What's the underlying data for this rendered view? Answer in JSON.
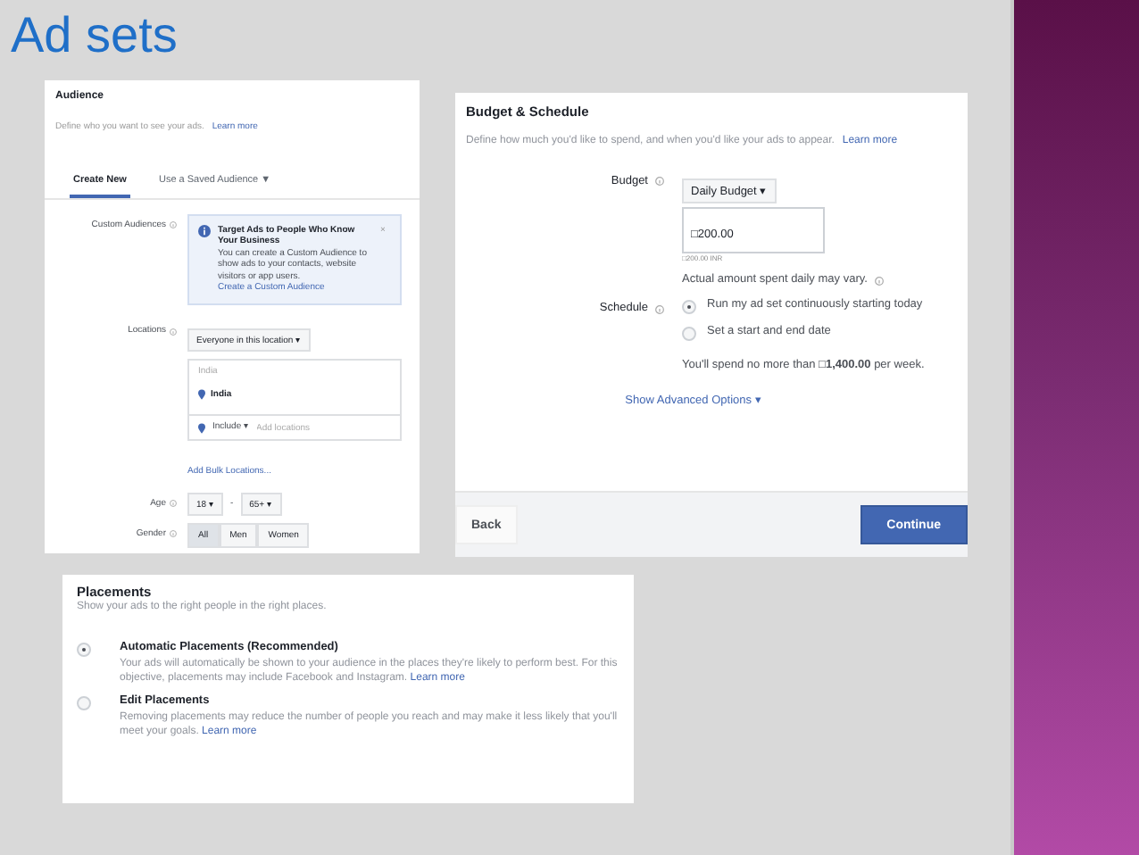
{
  "slide_title": "Ad sets",
  "audience": {
    "title": "Audience",
    "subtitle": "Define who you want to see your ads.",
    "subtitle_link": "Learn more",
    "tabs": [
      {
        "label": "Create New",
        "selected": true
      },
      {
        "label": "Use a Saved Audience ▼",
        "selected": false
      }
    ],
    "custom_audiences": {
      "label": "Custom Audiences",
      "notice_title": "Target Ads to People Who Know Your Business",
      "notice_body": "You can create a Custom Audience to show ads to your contacts, website visitors or app users.",
      "notice_link": "Create a Custom Audience",
      "close": "×"
    },
    "locations": {
      "label": "Locations",
      "dropdown": "Everyone in this location ▾",
      "search_hint": "India",
      "location": "India",
      "include": "Include ▾",
      "placeholder": "Add locations",
      "bulk_link": "Add Bulk Locations..."
    },
    "age": {
      "label": "Age",
      "from": "18 ▾",
      "dash": "-",
      "to": "65+ ▾"
    },
    "gender": {
      "label": "Gender",
      "options": [
        {
          "label": "All",
          "selected": true
        },
        {
          "label": "Men",
          "selected": false
        },
        {
          "label": "Women",
          "selected": false
        }
      ]
    }
  },
  "budget": {
    "title": "Budget & Schedule",
    "subtitle": "Define how much you'd like to spend, and when you'd like your ads to appear.",
    "subtitle_link": "Learn more",
    "budget_label": "Budget",
    "budget_type": "Daily Budget ▾",
    "amount": "□200.00",
    "amount_note": "□200.00 INR",
    "note": "Actual amount spent daily may vary.",
    "schedule_label": "Schedule",
    "schedule_options": [
      {
        "label": "Run my ad set continuously starting today",
        "selected": true
      },
      {
        "label": "Set a start and end date",
        "selected": false
      }
    ],
    "spend_note": "You'll spend no more than **□1,400.00** per week.",
    "advanced": "Show Advanced Options ▾",
    "back": "Back",
    "continue": "Continue"
  },
  "placements": {
    "title": "Placements",
    "subtitle": "Show your ads to the right people in the right places.",
    "options": [
      {
        "label": "Automatic Placements (Recommended)",
        "selected": true,
        "description": "Your ads will automatically be shown to your audience in the places they're likely to perform best. For this objective, placements may include Facebook and Instagram.",
        "link": "Learn more"
      },
      {
        "label": "Edit Placements",
        "selected": false,
        "description": "Removing placements may reduce the number of people you reach and may make it less likely that you'll meet your goals.",
        "link": "Learn more"
      }
    ]
  }
}
